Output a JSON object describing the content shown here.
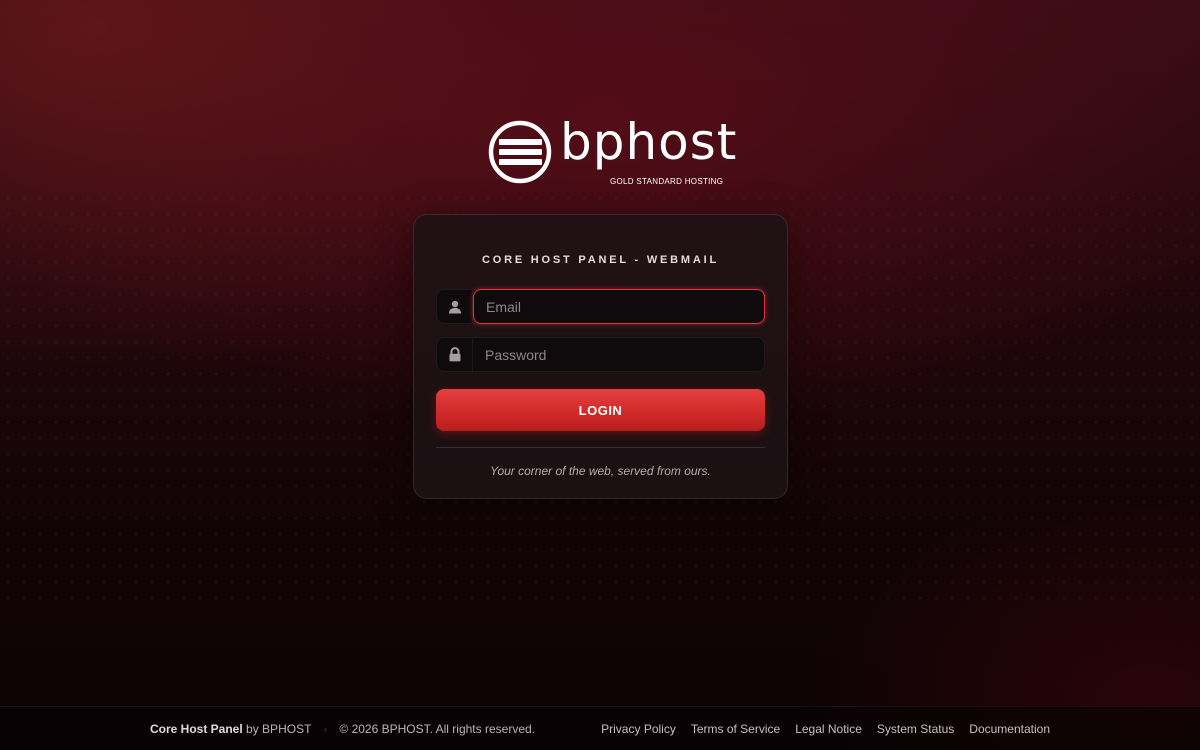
{
  "brand": {
    "name": "bphost",
    "tagline": "GOLD STANDARD HOSTING"
  },
  "login": {
    "title": "CORE HOST PANEL - WEBMAIL",
    "email_placeholder": "Email",
    "password_placeholder": "Password",
    "button_label": "LOGIN",
    "tagline": "Your corner of the web, served from ours."
  },
  "icons": {
    "email": "user-icon",
    "password": "lock-icon"
  },
  "colors": {
    "accent": "#d42b2b",
    "focus_ring": "#e0333b"
  },
  "footer": {
    "product": "Core Host Panel",
    "by": "by BPHOST",
    "separator": "·",
    "copyright": "© 2026 BPHOST. All rights reserved.",
    "links": [
      "Privacy Policy",
      "Terms of Service",
      "Legal Notice",
      "System Status",
      "Documentation"
    ]
  }
}
